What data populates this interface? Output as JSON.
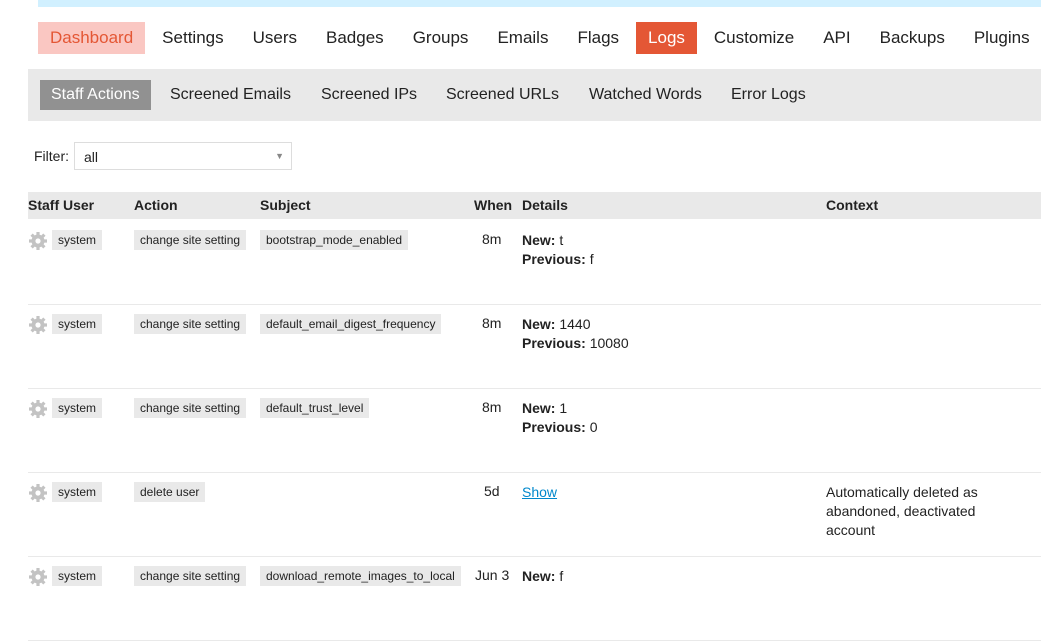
{
  "nav": {
    "tabs": [
      {
        "label": "Dashboard"
      },
      {
        "label": "Settings"
      },
      {
        "label": "Users"
      },
      {
        "label": "Badges"
      },
      {
        "label": "Groups"
      },
      {
        "label": "Emails"
      },
      {
        "label": "Flags"
      },
      {
        "label": "Logs",
        "active": true
      },
      {
        "label": "Customize"
      },
      {
        "label": "API"
      },
      {
        "label": "Backups"
      },
      {
        "label": "Plugins"
      }
    ],
    "accent_color": "#e45735",
    "dashboard_bg": "#fac7c2"
  },
  "subnav": {
    "tabs": [
      {
        "label": "Staff Actions",
        "active": true
      },
      {
        "label": "Screened Emails"
      },
      {
        "label": "Screened IPs"
      },
      {
        "label": "Screened URLs"
      },
      {
        "label": "Watched Words"
      },
      {
        "label": "Error Logs"
      }
    ]
  },
  "filter": {
    "label": "Filter:",
    "value": "all"
  },
  "table": {
    "headers": {
      "staff_user": "Staff User",
      "action": "Action",
      "subject": "Subject",
      "when": "When",
      "details": "Details",
      "context": "Context"
    },
    "rows": [
      {
        "user": "system",
        "action": "change site setting",
        "subject": "bootstrap_mode_enabled",
        "when": "8m",
        "new_label": "New:",
        "new": " t",
        "prev_label": "Previous:",
        "prev": " f"
      },
      {
        "user": "system",
        "action": "change site setting",
        "subject": "default_email_digest_frequency",
        "when": "8m",
        "new_label": "New:",
        "new": " 1440",
        "prev_label": "Previous:",
        "prev": " 10080"
      },
      {
        "user": "system",
        "action": "change site setting",
        "subject": "default_trust_level",
        "when": "8m",
        "new_label": "New:",
        "new": " 1",
        "prev_label": "Previous:",
        "prev": " 0"
      },
      {
        "user": "system",
        "action": "delete user",
        "when": "5d",
        "details_link": "Show",
        "context": "Automatically deleted as abandoned, deactivated account"
      },
      {
        "user": "system",
        "action": "change site setting",
        "subject": "download_remote_images_to_local",
        "when": "Jun 3",
        "new_label": "New:",
        "new": " f"
      }
    ]
  }
}
